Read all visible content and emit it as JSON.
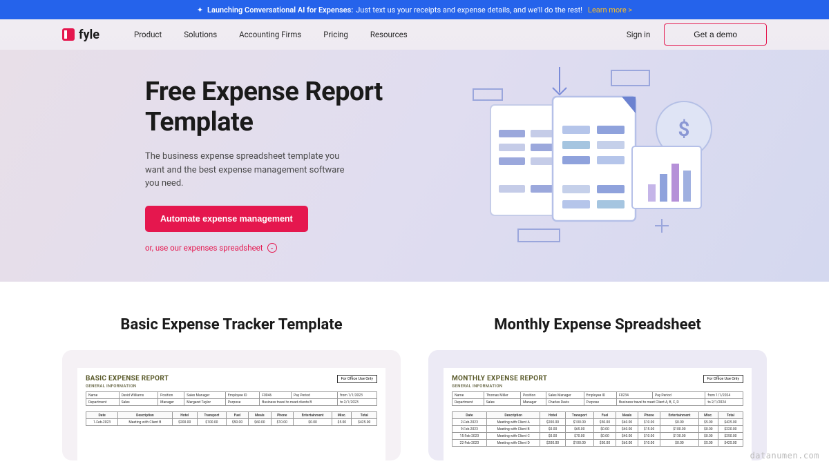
{
  "announce": {
    "bold": "Launching Conversational AI for Expenses:",
    "text": "Just text us your receipts and expense details, and we'll do the rest!",
    "cta": "Learn more >"
  },
  "nav": {
    "brand": "fyle",
    "links": [
      "Product",
      "Solutions",
      "Accounting Firms",
      "Pricing",
      "Resources"
    ],
    "signin": "Sign in",
    "demo": "Get a demo"
  },
  "hero": {
    "title": "Free Expense Report Template",
    "subtitle": "The business expense spreadsheet template you want and the best expense management software you need.",
    "cta": "Automate expense management",
    "alt": "or, use our expenses spreadsheet"
  },
  "templates": [
    {
      "heading": "Basic Expense Tracker Template",
      "sheet_title": "BASIC EXPENSE REPORT",
      "sheet_sub": "GENERAL INFORMATION",
      "office": "For Office Use Only",
      "info": {
        "name_l": "Name",
        "name_v": "David Williams",
        "pos_l": "Position",
        "pos_v": "Sales Manager",
        "emp_l": "Employee ID",
        "emp_v": "F0046",
        "pay_l": "Pay Period",
        "pay_v": "from 1/1/2023",
        "dept_l": "Department",
        "dept_v": "Sales",
        "mgr_l": "Manager",
        "mgr_v": "Margaret Taylor",
        "pur_l": "Purpose",
        "pur_v": "Business travel to meet clients B",
        "to_v": "to 2/1/2023"
      },
      "exp_head": [
        "Date",
        "Description",
        "Hotel",
        "Transport",
        "Fuel",
        "Meals",
        "Phone",
        "Entertainment",
        "Misc.",
        "Total"
      ],
      "exp_rows": [
        [
          "1-Feb-2023",
          "Meeting with Client B",
          "$200.00",
          "$100.00",
          "$50.00",
          "$60.00",
          "$10.00",
          "$0.00",
          "$5.00",
          "$425.00"
        ]
      ]
    },
    {
      "heading": "Monthly Expense Spreadsheet",
      "sheet_title": "MONTHLY EXPENSE REPORT",
      "sheet_sub": "GENERAL INFORMATION",
      "office": "For Office Use Only",
      "info": {
        "name_l": "Name",
        "name_v": "Thomas Miller",
        "pos_l": "Position",
        "pos_v": "Sales Manager",
        "emp_l": "Employee ID",
        "emp_v": "F0234",
        "pay_l": "Pay Period",
        "pay_v": "from 1/1/2024",
        "dept_l": "Department",
        "dept_v": "Sales",
        "mgr_l": "Manager",
        "mgr_v": "Charles Davis",
        "pur_l": "Purpose",
        "pur_v": "Business travel to meet Client A, B, C, D",
        "to_v": "to 2/1/2024"
      },
      "exp_head": [
        "Date",
        "Description",
        "Hotel",
        "Transport",
        "Fuel",
        "Meals",
        "Phone",
        "Entertainment",
        "Misc.",
        "Total"
      ],
      "exp_rows": [
        [
          "2-Feb-2023",
          "Meeting with Client A",
          "$200.00",
          "$100.00",
          "$50.00",
          "$60.00",
          "$10.00",
          "$0.00",
          "$5.00",
          "$425.00"
        ],
        [
          "9-Feb-2023",
          "Meeting with Client B",
          "$0.00",
          "$65.00",
          "$0.00",
          "$40.00",
          "$15.00",
          "$100.00",
          "$0.00",
          "$220.00"
        ],
        [
          "15-Feb-2023",
          "Meeting with Client C",
          "$0.00",
          "$70.00",
          "$0.00",
          "$40.00",
          "$10.00",
          "$130.00",
          "$0.00",
          "$250.00"
        ],
        [
          "22-Feb-2023",
          "Meeting with Client D",
          "$200.00",
          "$100.00",
          "$50.00",
          "$60.00",
          "$10.00",
          "$0.00",
          "$5.00",
          "$425.00"
        ]
      ]
    }
  ],
  "watermark": "datanumen.com"
}
